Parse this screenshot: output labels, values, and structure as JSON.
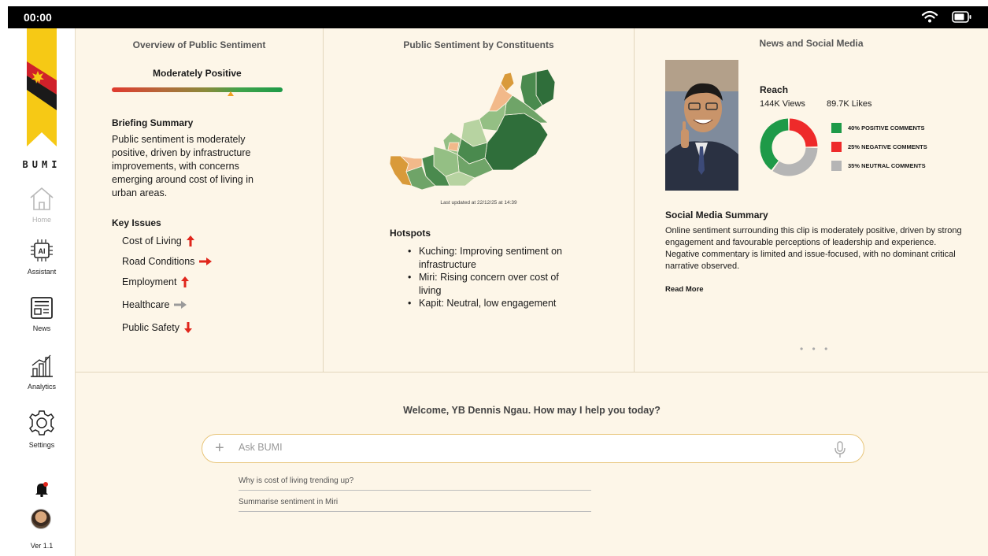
{
  "status_bar": {
    "time": "00:00"
  },
  "sidebar": {
    "brand": "BUMI",
    "items": [
      {
        "label": "Home",
        "icon": "home-icon"
      },
      {
        "label": "Assistant",
        "icon": "ai-chip-icon"
      },
      {
        "label": "News",
        "icon": "newspaper-icon"
      },
      {
        "label": "Analytics",
        "icon": "bar-chart-icon"
      },
      {
        "label": "Settings",
        "icon": "gear-icon"
      }
    ],
    "version": "Ver 1.1"
  },
  "overview": {
    "title": "Overview of Public Sentiment",
    "sentiment_label": "Moderately Positive",
    "sentiment_level": 0.71,
    "briefing_title": "Briefing Summary",
    "briefing_text": "Public sentiment is moderately positive, driven by infrastructure improvements, with concerns emerging around cost of living in urban areas.",
    "key_issues_title": "Key Issues",
    "issues": [
      {
        "label": "Cost of Living",
        "trend": "up",
        "color": "#e0261c"
      },
      {
        "label": "Road Conditions",
        "trend": "right",
        "color": "#e0261c"
      },
      {
        "label": "Employment",
        "trend": "up",
        "color": "#e0261c"
      },
      {
        "label": "Healthcare",
        "trend": "right",
        "color": "#9a9a9a"
      },
      {
        "label": "Public Safety",
        "trend": "down",
        "color": "#e0261c"
      }
    ]
  },
  "constituents": {
    "title": "Public Sentiment by Constituents",
    "updated": "Last updated at 22/12/25 at 14:39",
    "hotspots_title": "Hotspots",
    "hotspots": [
      "Kuching: Improving sentiment on infrastructure",
      "Miri: Rising concern over cost of living",
      "Kapit: Neutral, low engagement"
    ]
  },
  "news": {
    "title": "News and Social Media",
    "reach_title": "Reach",
    "views": "144K Views",
    "likes": "89.7K Likes",
    "breakdown": [
      {
        "label": "40% POSITIVE COMMENTS",
        "value": 40,
        "color": "#1e9a48"
      },
      {
        "label": "25% NEGATIVE COMMENTS",
        "value": 25,
        "color": "#ee2a2a"
      },
      {
        "label": "35% NEUTRAL COMMENTS",
        "value": 35,
        "color": "#b5b5b5"
      }
    ],
    "summary_title": "Social Media Summary",
    "summary_text": "Online sentiment surrounding this clip is moderately positive, driven by strong engagement and favourable perceptions of leadership and experience. Negative commentary is limited and issue-focused, with no dominant critical narrative observed.",
    "read_more": "Read More",
    "pager": "• • •"
  },
  "assistant": {
    "welcome": "Welcome, YB Dennis Ngau. How may I help you today?",
    "placeholder": "Ask BUMI",
    "suggestions": [
      "Why is cost of living trending up?",
      "Summarise sentiment in Miri"
    ]
  },
  "colors": {
    "accent": "#f6c915",
    "background": "#fdf6e8",
    "map_shades": [
      "#2f6e3a",
      "#4a8a4e",
      "#6fa468",
      "#94bf84",
      "#b7d3a1",
      "#f2b98a",
      "#d99a3a"
    ]
  }
}
